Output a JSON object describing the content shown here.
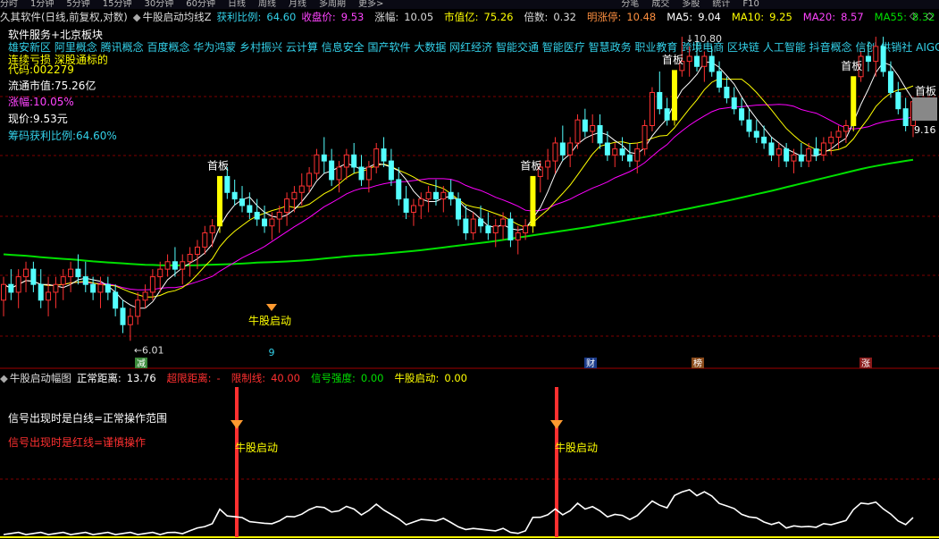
{
  "topbar": {
    "items": [
      "分时",
      "1分钟",
      "5分钟",
      "15分钟",
      "30分钟",
      "60分钟",
      "日线",
      "周线",
      "月线",
      "多周期",
      "更多>",
      "",
      "",
      "",
      "",
      "",
      "",
      "",
      "",
      "",
      "",
      "",
      "",
      "",
      "",
      "",
      "",
      "",
      "",
      "分笔",
      "成交",
      "多股",
      "统计",
      "F10"
    ]
  },
  "header": {
    "app_title": "久其软件(日线,前复权,对数)",
    "indicator_name": "牛股启动均线Z",
    "profit_label": "获利比例:",
    "profit_value": "64.60",
    "close_label": "收盘价:",
    "close_value": "9.53",
    "change_label": "涨幅:",
    "change_value": "10.05",
    "mktcap_label": "市值亿:",
    "mktcap_value": "75.26",
    "times_label": "倍数:",
    "times_value": "0.32",
    "limitup_label": "明涨停:",
    "limitup_value": "10.48",
    "ma5_label": "MA5:",
    "ma5_value": "9.04",
    "ma10_label": "MA10:",
    "ma10_value": "9.25",
    "ma20_label": "MA20:",
    "ma20_value": "8.57",
    "ma55_label": "MA55:",
    "ma55_value": "8.32",
    "collapse_icon": "diamond-icon"
  },
  "info": {
    "sector": "软件服务+北京板块",
    "concepts": "雄安新区 阿里概念 腾讯概念 百度概念 华为鸿蒙 乡村振兴 云计算 信息安全 国产软件 大数据 网红经济 智能交通 智能医疗 智慧政务 职业教育 跨境电商 区块链 人工智能 抖音概念 信创 供销社 AIGC概",
    "note": "连续亏损 深股通标的",
    "code_label": "代码:",
    "code_value": "002279",
    "float_cap_label": "流通市值:",
    "float_cap_value": "75.26亿",
    "change_label": "涨幅:",
    "change_value": "10.05%",
    "price_label": "现价:",
    "price_value": "9.53元",
    "chip_label": "筹码获利比例:",
    "chip_value": "64.60%"
  },
  "annotations": {
    "first_board": "首板",
    "bull_start": "牛股启动",
    "low_price": "6.01",
    "high_price": "10.80",
    "right_price": "9.16",
    "count_label": "9",
    "badges": [
      "减",
      "财",
      "榜",
      "涨"
    ]
  },
  "lower": {
    "title": "牛股启动幅图",
    "normal_label": "正常距离:",
    "normal_value": "13.76",
    "over_label": "超限距离:",
    "over_value": "-",
    "limit_label": "限制线:",
    "limit_value": "40.00",
    "strength_label": "信号强度:",
    "strength_value": "0.00",
    "bull_label": "牛股启动:",
    "bull_value": "0.00",
    "note_white": "信号出现时是白线=正常操作范围",
    "note_red": "信号出现时是红线=谨慎操作"
  },
  "colors": {
    "up": "#ff3232",
    "down": "#54ffff",
    "limit_up": "#ffff00",
    "ma5": "#ffffff",
    "ma10": "#ffff00",
    "ma20": "#ff00ff",
    "ma55": "#00e000",
    "profit": "#33d0e8",
    "accent_red": "#ff3030",
    "label_yellow": "#ffff00",
    "grid": "#800000"
  },
  "chart_data": {
    "type": "candlestick",
    "title": "久其软件(日线,前复权,对数)",
    "scale": "log",
    "ohlc": [
      [
        6.5,
        6.8,
        6.3,
        6.7
      ],
      [
        6.7,
        6.9,
        6.5,
        6.6
      ],
      [
        6.6,
        6.9,
        6.4,
        6.8
      ],
      [
        6.8,
        7.0,
        6.6,
        6.9
      ],
      [
        6.9,
        7.0,
        6.6,
        6.7
      ],
      [
        6.7,
        6.9,
        6.4,
        6.5
      ],
      [
        6.5,
        6.8,
        6.3,
        6.6
      ],
      [
        6.6,
        6.8,
        6.4,
        6.7
      ],
      [
        6.7,
        6.9,
        6.5,
        6.8
      ],
      [
        6.8,
        7.0,
        6.6,
        6.9
      ],
      [
        6.9,
        7.1,
        6.7,
        6.8
      ],
      [
        6.8,
        7.0,
        6.6,
        6.7
      ],
      [
        6.7,
        6.8,
        6.5,
        6.6
      ],
      [
        6.6,
        6.8,
        6.4,
        6.7
      ],
      [
        6.7,
        6.8,
        6.5,
        6.6
      ],
      [
        6.6,
        6.7,
        6.3,
        6.4
      ],
      [
        6.4,
        6.5,
        6.1,
        6.2
      ],
      [
        6.2,
        6.4,
        6.01,
        6.3
      ],
      [
        6.3,
        6.6,
        6.2,
        6.5
      ],
      [
        6.5,
        6.7,
        6.4,
        6.6
      ],
      [
        6.6,
        6.9,
        6.5,
        6.8
      ],
      [
        6.8,
        7.0,
        6.6,
        6.9
      ],
      [
        6.9,
        7.1,
        6.8,
        7.0
      ],
      [
        7.0,
        7.2,
        6.8,
        6.9
      ],
      [
        6.9,
        7.1,
        6.7,
        7.0
      ],
      [
        7.0,
        7.2,
        6.8,
        7.1
      ],
      [
        7.1,
        7.3,
        6.9,
        7.2
      ],
      [
        7.2,
        7.5,
        7.1,
        7.4
      ],
      [
        7.4,
        7.6,
        7.2,
        7.5
      ],
      [
        7.5,
        8.25,
        7.4,
        8.25
      ],
      [
        8.25,
        8.4,
        7.9,
        8.0
      ],
      [
        8.0,
        8.2,
        7.8,
        7.9
      ],
      [
        7.9,
        8.1,
        7.7,
        7.8
      ],
      [
        7.8,
        8.0,
        7.6,
        7.7
      ],
      [
        7.7,
        7.9,
        7.5,
        7.6
      ],
      [
        7.6,
        7.8,
        7.4,
        7.5
      ],
      [
        7.5,
        7.7,
        7.3,
        7.6
      ],
      [
        7.6,
        7.8,
        7.4,
        7.7
      ],
      [
        7.7,
        8.0,
        7.5,
        7.9
      ],
      [
        7.9,
        8.1,
        7.7,
        8.0
      ],
      [
        8.0,
        8.3,
        7.8,
        8.1
      ],
      [
        8.1,
        8.4,
        8.0,
        8.3
      ],
      [
        8.3,
        8.7,
        8.2,
        8.6
      ],
      [
        8.6,
        8.9,
        8.3,
        8.5
      ],
      [
        8.5,
        8.7,
        8.1,
        8.2
      ],
      [
        8.2,
        8.5,
        8.0,
        8.4
      ],
      [
        8.4,
        8.7,
        8.2,
        8.6
      ],
      [
        8.6,
        8.8,
        8.3,
        8.4
      ],
      [
        8.4,
        8.6,
        8.1,
        8.2
      ],
      [
        8.2,
        8.5,
        8.0,
        8.4
      ],
      [
        8.4,
        8.8,
        8.3,
        8.7
      ],
      [
        8.7,
        8.9,
        8.4,
        8.5
      ],
      [
        8.5,
        8.7,
        8.1,
        8.2
      ],
      [
        8.2,
        8.4,
        7.8,
        7.9
      ],
      [
        7.9,
        8.1,
        7.6,
        7.7
      ],
      [
        7.7,
        7.9,
        7.5,
        7.8
      ],
      [
        7.8,
        8.0,
        7.6,
        7.9
      ],
      [
        7.9,
        8.1,
        7.7,
        8.0
      ],
      [
        8.0,
        8.2,
        7.8,
        7.9
      ],
      [
        7.9,
        8.1,
        7.7,
        8.0
      ],
      [
        8.0,
        8.2,
        7.8,
        7.9
      ],
      [
        7.9,
        8.0,
        7.5,
        7.6
      ],
      [
        7.6,
        7.8,
        7.3,
        7.4
      ],
      [
        7.4,
        7.7,
        7.3,
        7.6
      ],
      [
        7.6,
        7.8,
        7.4,
        7.5
      ],
      [
        7.5,
        7.7,
        7.3,
        7.4
      ],
      [
        7.4,
        7.6,
        7.2,
        7.5
      ],
      [
        7.5,
        7.7,
        7.3,
        7.6
      ],
      [
        7.6,
        7.7,
        7.2,
        7.3
      ],
      [
        7.3,
        7.5,
        7.1,
        7.4
      ],
      [
        7.4,
        7.6,
        7.3,
        7.5
      ],
      [
        7.5,
        8.25,
        7.4,
        8.25
      ],
      [
        8.25,
        8.5,
        8.0,
        8.4
      ],
      [
        8.4,
        8.7,
        8.2,
        8.5
      ],
      [
        8.5,
        8.9,
        8.3,
        8.8
      ],
      [
        8.8,
        9.1,
        8.5,
        8.6
      ],
      [
        8.6,
        8.9,
        8.4,
        8.8
      ],
      [
        8.8,
        9.3,
        8.7,
        9.2
      ],
      [
        9.2,
        9.4,
        8.9,
        9.0
      ],
      [
        9.0,
        9.3,
        8.8,
        9.1
      ],
      [
        9.1,
        9.3,
        8.7,
        8.8
      ],
      [
        8.8,
        9.0,
        8.5,
        8.6
      ],
      [
        8.6,
        8.8,
        8.4,
        8.7
      ],
      [
        8.7,
        8.9,
        8.5,
        8.6
      ],
      [
        8.6,
        8.8,
        8.4,
        8.5
      ],
      [
        8.5,
        8.8,
        8.3,
        8.7
      ],
      [
        8.7,
        9.2,
        8.6,
        9.1
      ],
      [
        9.1,
        9.8,
        9.0,
        9.7
      ],
      [
        9.7,
        10.1,
        9.3,
        9.4
      ],
      [
        9.4,
        9.6,
        9.1,
        9.2
      ],
      [
        9.2,
        10.12,
        9.1,
        10.12
      ],
      [
        10.12,
        10.8,
        10.0,
        10.3
      ],
      [
        10.3,
        10.6,
        10.0,
        10.4
      ],
      [
        10.4,
        10.7,
        10.1,
        10.2
      ],
      [
        10.2,
        10.5,
        9.9,
        10.4
      ],
      [
        10.4,
        10.6,
        10.0,
        10.1
      ],
      [
        10.1,
        10.3,
        9.7,
        9.8
      ],
      [
        9.8,
        10.0,
        9.5,
        9.6
      ],
      [
        9.6,
        9.8,
        9.3,
        9.4
      ],
      [
        9.4,
        9.6,
        9.1,
        9.2
      ],
      [
        9.2,
        9.4,
        8.9,
        9.0
      ],
      [
        9.0,
        9.2,
        8.8,
        8.9
      ],
      [
        8.9,
        9.1,
        8.7,
        8.8
      ],
      [
        8.8,
        8.9,
        8.5,
        8.6
      ],
      [
        8.6,
        8.8,
        8.4,
        8.7
      ],
      [
        8.7,
        8.8,
        8.4,
        8.5
      ],
      [
        8.5,
        8.7,
        8.3,
        8.6
      ],
      [
        8.6,
        8.8,
        8.4,
        8.5
      ],
      [
        8.5,
        8.8,
        8.4,
        8.7
      ],
      [
        8.7,
        8.9,
        8.5,
        8.6
      ],
      [
        8.6,
        8.9,
        8.5,
        8.8
      ],
      [
        8.8,
        9.0,
        8.6,
        8.9
      ],
      [
        8.9,
        9.1,
        8.7,
        9.0
      ],
      [
        9.0,
        9.2,
        8.8,
        9.1
      ],
      [
        9.1,
        10.0,
        9.0,
        10.0
      ],
      [
        10.0,
        10.5,
        9.9,
        10.4
      ],
      [
        10.4,
        10.7,
        10.1,
        10.3
      ],
      [
        10.3,
        10.8,
        10.0,
        10.6
      ],
      [
        10.6,
        10.8,
        10.0,
        10.1
      ],
      [
        10.1,
        10.3,
        9.6,
        9.7
      ],
      [
        9.7,
        9.9,
        9.3,
        9.4
      ],
      [
        9.4,
        9.6,
        9.0,
        9.1
      ],
      [
        9.1,
        9.6,
        8.9,
        9.53
      ]
    ],
    "ma55": [
      7.1,
      7.08,
      7.05,
      7.03,
      7.0,
      6.98,
      6.96,
      6.95,
      6.95,
      6.96,
      6.97,
      6.99,
      7.0,
      7.02,
      7.05,
      7.08,
      7.1,
      7.13,
      7.16,
      7.2,
      7.24,
      7.28,
      7.33,
      7.38,
      7.43,
      7.48,
      7.54,
      7.6,
      7.66,
      7.73,
      7.8,
      7.87,
      7.95,
      8.03,
      8.12,
      8.21,
      8.3,
      8.39,
      8.46,
      8.52
    ]
  }
}
